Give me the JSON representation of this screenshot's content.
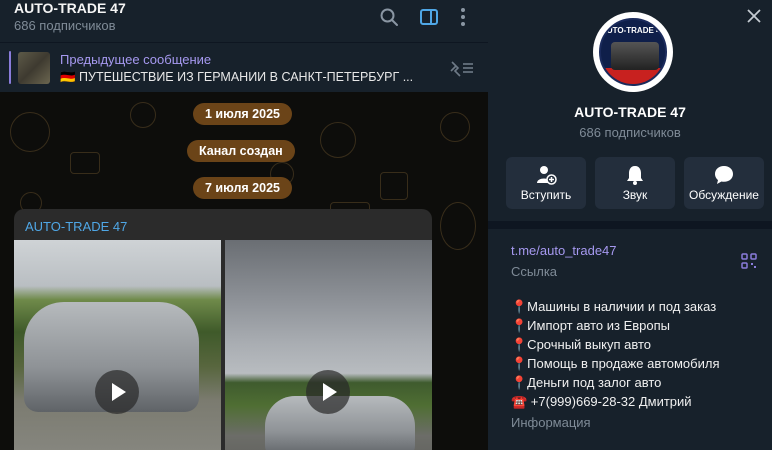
{
  "chat": {
    "title": "AUTO-TRADE 47",
    "subscribers": "686 подписчиков",
    "pinned": {
      "label": "Предыдущее сообщение",
      "text": "🇩🇪 ПУТЕШЕСТВИЕ ИЗ ГЕРМАНИИ В САНКТ-ПЕТЕРБУРГ ..."
    },
    "dates": [
      "1 июля 2025",
      "Канал создан",
      "7 июля 2025"
    ],
    "message": {
      "author": "AUTO-TRADE 47"
    },
    "icons": [
      "search-icon",
      "sidebar-toggle-icon",
      "more-vertical-icon",
      "pin-list-icon",
      "play-icon"
    ]
  },
  "side": {
    "logo_text": "AUTO-TRADE 47",
    "name": "AUTO-TRADE 47",
    "subscribers": "686 подписчиков",
    "actions": [
      {
        "label": "Вступить",
        "icon": "add-user-icon"
      },
      {
        "label": "Звук",
        "icon": "bell-icon"
      },
      {
        "label": "Обсуждение",
        "icon": "chat-bubble-icon"
      }
    ],
    "link": "t.me/auto_trade47",
    "link_caption": "Ссылка",
    "info_lines": [
      "📍Машины в наличии и под заказ",
      "📍Импорт авто из Европы",
      "📍Срочный выкуп авто",
      "📍Помощь в продаже автомобиля",
      "📍Деньги под залог авто",
      "☎️ +7(999)669-28-32 Дмитрий"
    ],
    "info_caption": "Информация"
  },
  "colors": {
    "accent_purple": "#a699f0",
    "author_blue": "#4fa7e6",
    "date_pill": "#6b4418",
    "panel_bg": "#17212b"
  }
}
